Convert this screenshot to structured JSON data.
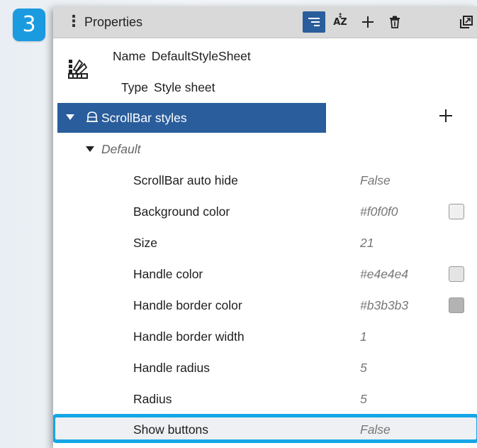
{
  "step": {
    "number": "3",
    "color": "#1a9be0"
  },
  "panel": {
    "title": "Properties",
    "toolbar": [
      {
        "icon": "categorized-list-icon",
        "active": true
      },
      {
        "icon": "sort-az-icon",
        "label": "AZ"
      },
      {
        "icon": "add-icon"
      },
      {
        "icon": "delete-icon"
      },
      {
        "icon": "float-window-icon"
      }
    ],
    "info": {
      "name_label": "Name",
      "name_value": "DefaultStyleSheet",
      "type_label": "Type",
      "type_value": "Style sheet",
      "icon": "style-sheet-icon"
    },
    "category": {
      "label": "ScrollBar styles",
      "icon": "paint-bucket-icon",
      "expanded": true
    },
    "subgroup": {
      "label": "Default",
      "expanded": true
    },
    "properties": [
      {
        "name": "ScrollBar auto hide",
        "value": "False"
      },
      {
        "name": "Background color",
        "value": "#f0f0f0",
        "swatch": "#f0f0f0"
      },
      {
        "name": "Size",
        "value": "21"
      },
      {
        "name": "Handle color",
        "value": "#e4e4e4",
        "swatch": "#e4e4e4"
      },
      {
        "name": "Handle border color",
        "value": "#b3b3b3",
        "swatch": "#b3b3b3"
      },
      {
        "name": "Handle border width",
        "value": "1"
      },
      {
        "name": "Handle radius",
        "value": "5"
      },
      {
        "name": "Radius",
        "value": "5"
      },
      {
        "name": "Show buttons",
        "value": "False",
        "highlighted": true
      }
    ],
    "colors": {
      "accent": "#2a5d9c",
      "highlight_border": "#14a6e6",
      "titlebar": "#d9d9d9"
    }
  }
}
